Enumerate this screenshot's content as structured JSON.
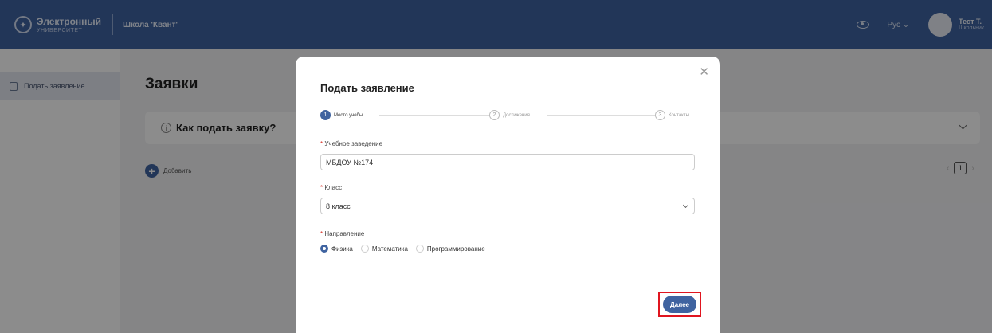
{
  "header": {
    "logo_line1": "Электронный",
    "logo_line2": "УНИВЕРСИТЕТ",
    "school": "Школа 'Квант'",
    "language": "Рус",
    "user_name": "Тест Т.",
    "user_role": "Школьник",
    "icons": [
      "eye-icon",
      "chevron-down-icon"
    ]
  },
  "sidebar": {
    "items": [
      {
        "label": "Подать заявление",
        "icon": "document-icon",
        "active": true
      }
    ]
  },
  "main": {
    "title": "Заявки",
    "howto_label": "Как подать заявку?",
    "add_label": "Добавить",
    "pagination": {
      "current_page": "1"
    }
  },
  "modal": {
    "title": "Подать заявление",
    "steps": [
      {
        "number": "1",
        "label": "Место учебы",
        "active": true
      },
      {
        "number": "2",
        "label": "Достижения",
        "active": false
      },
      {
        "number": "3",
        "label": "Контакты",
        "active": false
      }
    ],
    "fields": {
      "institution": {
        "label": "Учебное заведение",
        "value": "МБДОУ №174"
      },
      "class": {
        "label": "Класс",
        "value": "8 класс"
      },
      "direction": {
        "label": "Направление",
        "options": [
          "Физика",
          "Математика",
          "Программирование"
        ],
        "selected": "Физика"
      }
    },
    "next_label": "Далее"
  },
  "colors": {
    "brand": "#3f63a0",
    "highlight": "#e0151f",
    "required": "#d93025"
  }
}
